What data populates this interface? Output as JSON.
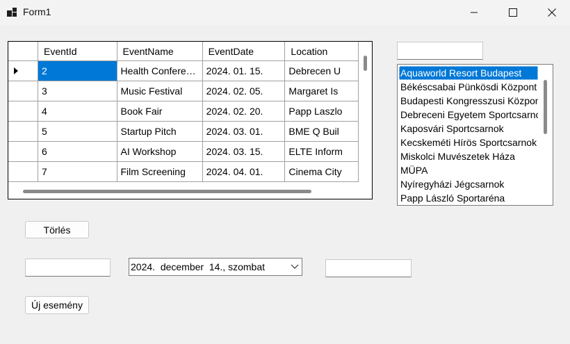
{
  "window": {
    "title": "Form1",
    "minimize_icon": "minimize-icon",
    "maximize_icon": "maximize-icon",
    "close_icon": "close-icon"
  },
  "grid": {
    "columns": [
      "EventId",
      "EventName",
      "EventDate",
      "Location"
    ],
    "rows": [
      [
        "2",
        "Health Confere…",
        "2024. 01. 15.",
        "Debrecen U"
      ],
      [
        "3",
        "Music Festival",
        "2024. 02. 05.",
        "Margaret Is"
      ],
      [
        "4",
        "Book Fair",
        "2024. 02. 20.",
        "Papp Laszlo"
      ],
      [
        "5",
        "Startup Pitch",
        "2024. 03. 01.",
        "BME Q Buil"
      ],
      [
        "6",
        "AI Workshop",
        "2024. 03. 15.",
        "ELTE Inform"
      ],
      [
        "7",
        "Film Screening",
        "2024. 04. 01.",
        "Cinema City"
      ]
    ],
    "selected_row": 0
  },
  "filter_input": {
    "value": ""
  },
  "locations": {
    "items": [
      "Aquaworld Resort Budapest",
      "Békéscsabai Pünkösdi Központ",
      "Budapesti Kongresszusi Központ",
      "Debreceni Egyetem Sportcsarnok",
      "Kaposvári Sportcsarnok",
      "Kecskeméti Hírös Sportcsarnok",
      "Miskolci Muvészetek Háza",
      "MÜPA",
      "Nyíregyházi Jégcsarnok",
      "Papp László Sportaréna"
    ],
    "selected_index": 0
  },
  "buttons": {
    "delete_label": "Törlés",
    "new_event_label": "Új esemény"
  },
  "new_event": {
    "name_value": "",
    "date_value": "2024.  december  14., szombat",
    "location_value": ""
  },
  "colors": {
    "selection": "#0078d7",
    "background": "#f0f0f0"
  }
}
